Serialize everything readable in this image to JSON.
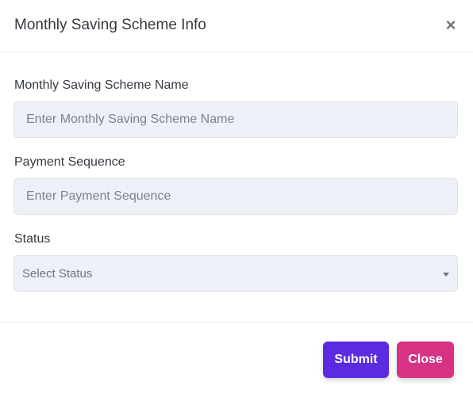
{
  "modal": {
    "title": "Monthly Saving Scheme Info",
    "close_glyph": "×"
  },
  "form": {
    "scheme_name": {
      "label": "Monthly Saving Scheme Name",
      "placeholder": "Enter Monthly Saving Scheme Name",
      "value": ""
    },
    "payment_sequence": {
      "label": "Payment Sequence",
      "placeholder": "Enter Payment Sequence",
      "value": ""
    },
    "status": {
      "label": "Status",
      "selected": "Select Status"
    }
  },
  "footer": {
    "submit_label": "Submit",
    "close_label": "Close"
  },
  "colors": {
    "submit": "#5b2be0",
    "close": "#d63384",
    "input_bg": "#eef0f8"
  },
  "icons": {
    "close": "close-icon",
    "dropdown": "chevron-down-icon"
  }
}
